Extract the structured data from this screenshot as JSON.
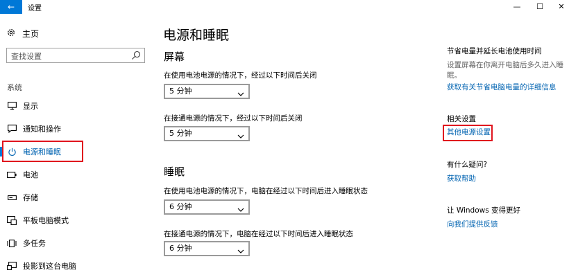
{
  "window": {
    "title": "设置",
    "back_icon": "←",
    "minimize_icon": "—",
    "maximize_icon": "☐",
    "close_icon": "✕"
  },
  "sidebar": {
    "home_label": "主页",
    "search_placeholder": "查找设置",
    "section_label": "系统",
    "items": [
      {
        "label": "显示",
        "icon": "monitor-icon"
      },
      {
        "label": "通知和操作",
        "icon": "notification-icon"
      },
      {
        "label": "电源和睡眠",
        "icon": "power-icon",
        "active": true
      },
      {
        "label": "电池",
        "icon": "battery-icon"
      },
      {
        "label": "存储",
        "icon": "storage-icon"
      },
      {
        "label": "平板电脑模式",
        "icon": "tablet-mode-icon"
      },
      {
        "label": "多任务",
        "icon": "multitask-icon"
      },
      {
        "label": "投影到这台电脑",
        "icon": "project-icon"
      }
    ]
  },
  "main": {
    "title": "电源和睡眠",
    "screen": {
      "heading": "屏幕",
      "battery_label": "在使用电池电源的情况下，经过以下时间后关闭",
      "battery_value": "5 分钟",
      "plugged_label": "在接通电源的情况下，经过以下时间后关闭",
      "plugged_value": "5 分钟"
    },
    "sleep": {
      "heading": "睡眠",
      "battery_label": "在使用电池电源的情况下，电脑在经过以下时间后进入睡眠状态",
      "battery_value": "6 分钟",
      "plugged_label": "在接通电源的情况下，电脑在经过以下时间后进入睡眠状态",
      "plugged_value": "6 分钟"
    }
  },
  "right": {
    "tip_title": "节省电量并延长电池使用时间",
    "tip_desc": "设置屏幕在你离开电脑后多久进入睡眠。",
    "tip_link": "获取有关节省电脑电量的详细信息",
    "related_title": "相关设置",
    "related_link": "其他电源设置",
    "question_title": "有什么疑问?",
    "help_link": "获取帮助",
    "improve_title": "让 Windows 变得更好",
    "feedback_link": "向我们提供反馈"
  },
  "colors": {
    "accent": "#0078d7",
    "link": "#0063b1",
    "highlight": "#e0141e"
  }
}
